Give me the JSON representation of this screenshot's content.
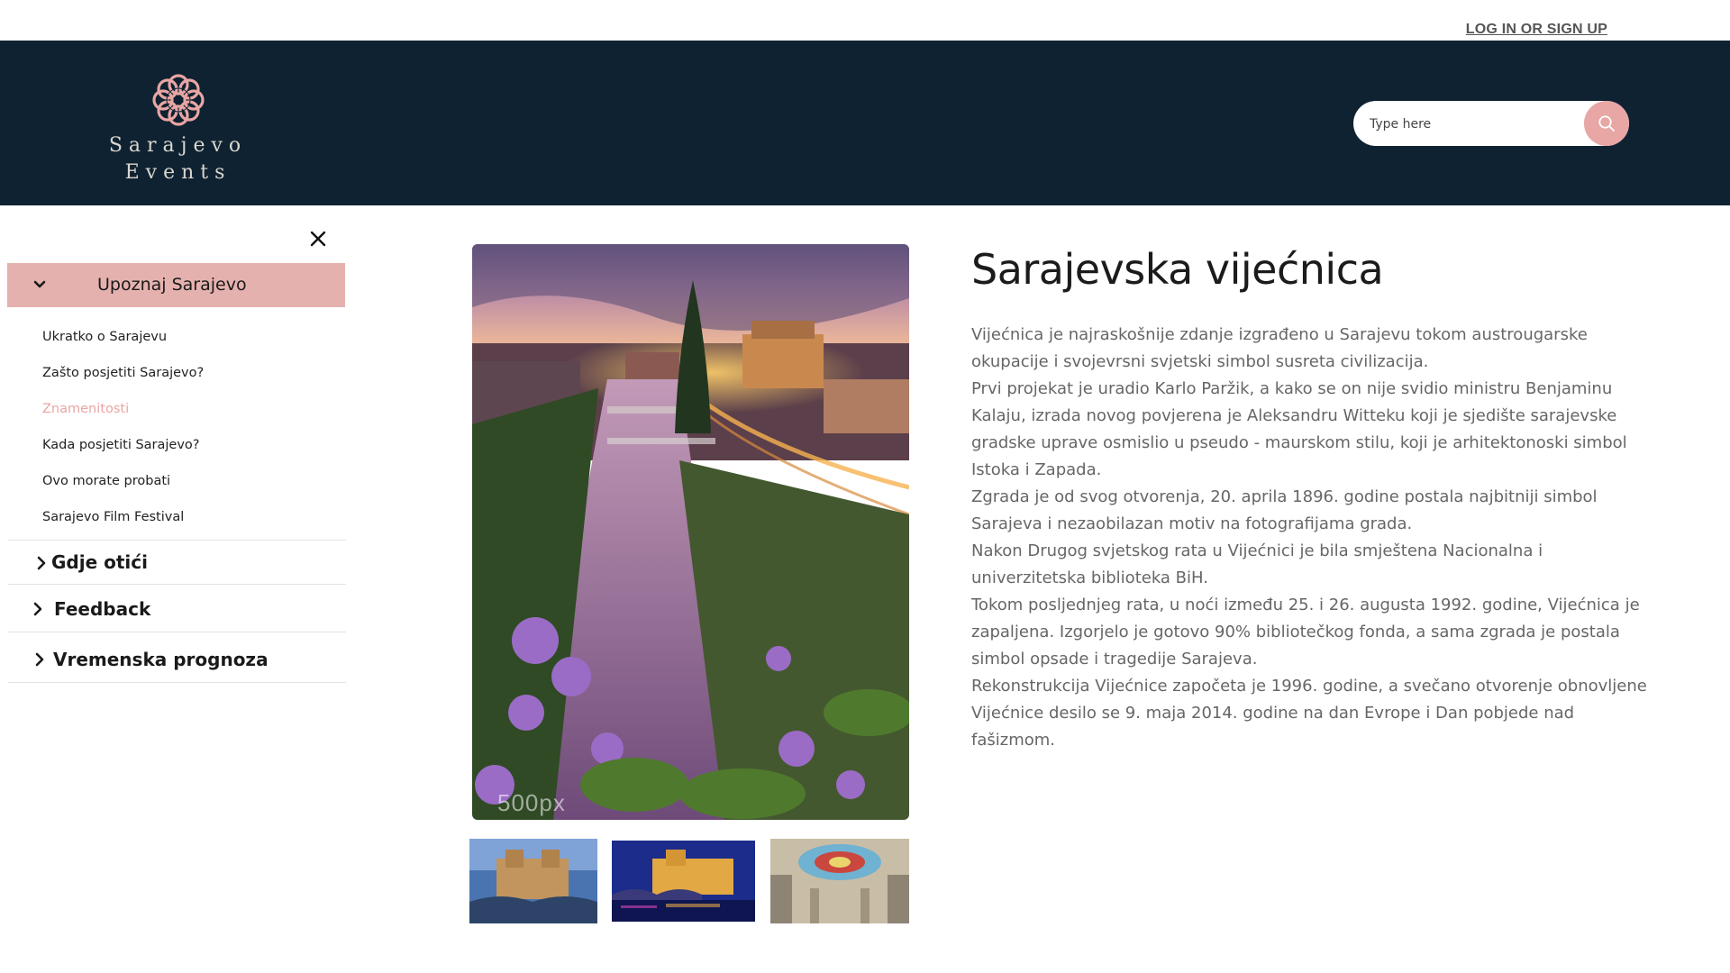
{
  "top": {
    "login_label": "LOG IN OR SIGN UP"
  },
  "header": {
    "logo_line1": "Sarajevo",
    "logo_line2": "Events",
    "search_placeholder": "Type here"
  },
  "sidebar": {
    "open_section": "Upoznaj Sarajevo",
    "subitems": [
      "Ukratko o Sarajevu",
      "Zašto posjetiti Sarajevo?",
      "Znamenitosti",
      "Kada posjetiti Sarajevo?",
      "Ovo morate probati",
      "Sarajevo Film Festival"
    ],
    "active_subitem": "Znamenitosti",
    "sections": [
      "Gdje otići",
      "Feedback",
      "Vremenska prognoza"
    ]
  },
  "gallery": {
    "watermark": "500px"
  },
  "article": {
    "title": "Sarajevska vijećnica",
    "paragraphs": [
      "Vijećnica je najraskošnije zdanje izgrađeno u Sarajevu tokom austrougarske okupacije i svojevrsni svjetski simbol susreta civilizacija.",
      "Prvi projekat je uradio Karlo Paržik, a kako se on nije svidio ministru Benjaminu Kalaju, izrada novog  povjerena je Aleksandru Witteku koji je sjedište sarajevske gradske uprave osmislio u pseudo - maurskom stilu, koji je arhitektonoski simbol Istoka i Zapada.",
      "Zgrada je od svog otvorenja, 20. aprila 1896. godine postala najbitniji simbol Sarajeva i nezaobilazan motiv na fotografijama grada.",
      "Nakon Drugog svjetskog rata u Vijećnici je bila smještena Nacionalna i univerzitetska biblioteka BiH.",
      "Tokom posljednjeg rata, u noći između 25. i 26. augusta 1992. godine, Vijećnica je zapaljena. Izgorjelo je gotovo 90% bibliotečkog fonda, a sama zgrada je postala simbol opsade i tragedije Sarajeva.",
      "Rekonstrukcija Vijećnice započeta je 1996. godine, a svečano otvorenje obnovljene Vijećnice desilo se 9. maja 2014. godine na dan Evrope i Dan pobjede nad fašizmom."
    ]
  },
  "colors": {
    "header_bg": "#0f2231",
    "accent": "#e8a6a4",
    "open_section_bg": "#e5b1ae"
  }
}
